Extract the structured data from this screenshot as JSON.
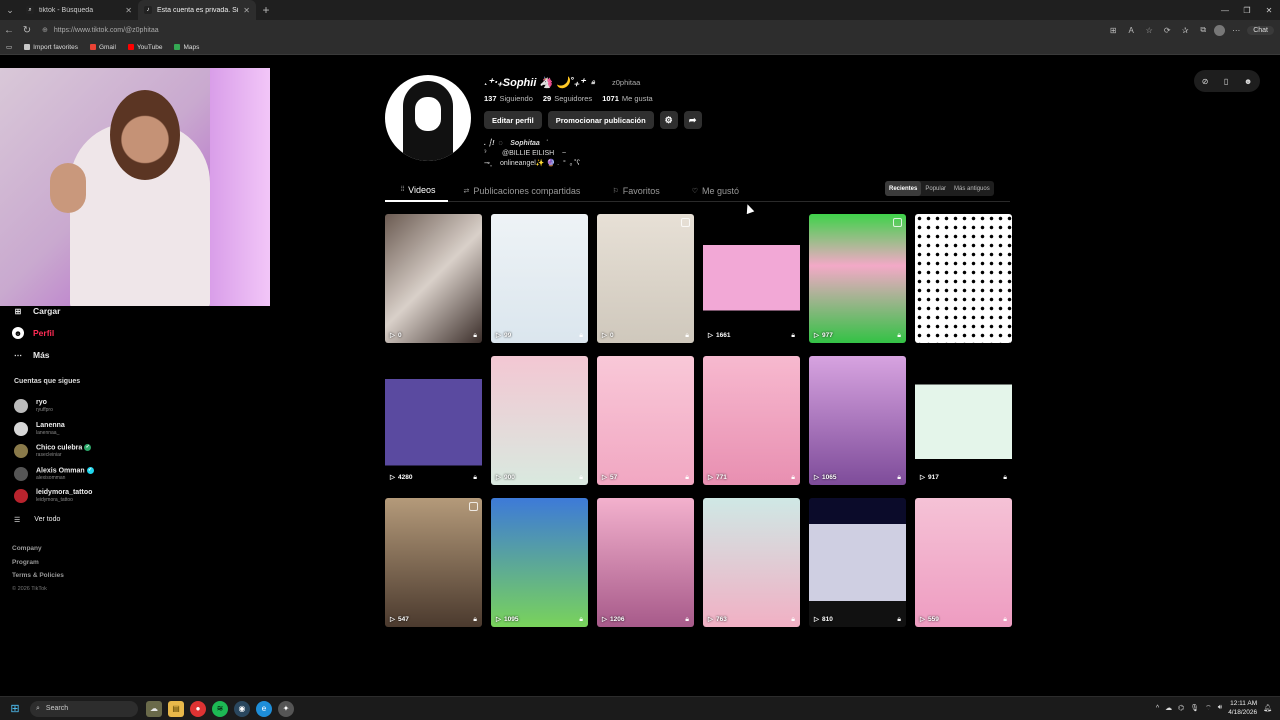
{
  "browser": {
    "tabs": [
      {
        "title": "tiktok - Búsqueda",
        "active": false
      },
      {
        "title": "Esta cuenta es privada. Sigue esta",
        "active": true
      }
    ],
    "url": "https://www.tiktok.com/@z0phitaa",
    "chat_label": "Chat",
    "bookmarks": [
      {
        "label": "Import favorites",
        "color": "#c8c8c8"
      },
      {
        "label": "Gmail",
        "color": "#ea4335"
      },
      {
        "label": "YouTube",
        "color": "#ff0000"
      },
      {
        "label": "Maps",
        "color": "#34a853"
      }
    ]
  },
  "sidebar": {
    "items": [
      {
        "label": "Cargar",
        "icon": "plus-square-icon",
        "active": false
      },
      {
        "label": "Perfil",
        "icon": "profile-icon",
        "active": true
      },
      {
        "label": "Más",
        "icon": "more-icon",
        "active": false
      }
    ],
    "following_heading": "Cuentas que sigues",
    "following": [
      {
        "name": "ryo",
        "user": "ryuffpro",
        "color": "#bbbbbb",
        "verified": ""
      },
      {
        "name": "Lanenna",
        "user": "lanennaa_",
        "color": "#d6d6d6",
        "verified": ""
      },
      {
        "name": "Chico culebra",
        "user": "rasecleiniar",
        "color": "#8a7a4a",
        "verified": "green"
      },
      {
        "name": "Alexis Omman",
        "user": "alexisomman",
        "color": "#555555",
        "verified": "blue"
      },
      {
        "name": "leidymora_tattoo",
        "user": "leidymora_tattoo",
        "color": "#b8232d",
        "verified": ""
      }
    ],
    "see_all": "Ver todo",
    "footer": [
      "Company",
      "Program",
      "Terms & Policies"
    ],
    "copyright": "© 2026 TikTok"
  },
  "profile": {
    "display_name": "˖⁺‧₊Sophii 🦄 🌙˚₊⁺",
    "handle": "z0phitaa",
    "following_count": "137",
    "following_label": "Siguiendo",
    "followers_count": "29",
    "followers_label": "Seguidores",
    "likes_count": "1071",
    "likes_label": "Me gusta",
    "edit_label": "Editar perfil",
    "promote_label": "Promocionar publicación",
    "bio_line1": ". ┆!  ◌    Sophitaa   ˙",
    "bio_line2": "ˀ        @BILLIE EILISH    ~",
    "bio_line3": "⊸˳    onlineangel✨ 🔮 .  °  ₒ ˚ʕ"
  },
  "tabs": [
    {
      "label": "Videos",
      "icon": "grid-icon",
      "active": true
    },
    {
      "label": "Publicaciones compartidas",
      "icon": "repost-icon",
      "active": false
    },
    {
      "label": "Favoritos",
      "icon": "bookmark-icon",
      "active": false
    },
    {
      "label": "Me gustó",
      "icon": "heart-icon",
      "active": false
    }
  ],
  "sort": [
    {
      "label": "Recientes",
      "active": true
    },
    {
      "label": "Popular",
      "active": false
    },
    {
      "label": "Más antiguos",
      "active": false
    }
  ],
  "videos": [
    {
      "views": "0",
      "bg": "linear-gradient(135deg,#6b5b52,#d9d0c9 50%,#3b2e2a)"
    },
    {
      "views": "99",
      "bg": "linear-gradient(180deg,#eef3f6,#dbe6ee)"
    },
    {
      "views": "0",
      "bg": "linear-gradient(180deg,#e7e0d6,#cfc8bc)"
    },
    {
      "views": "1661",
      "bg": "linear-gradient(180deg,#000 0 24%,#f2a8d6 24% 75%,#000 75%)"
    },
    {
      "views": "977",
      "bg": "linear-gradient(180deg,#3fd24a,#f3a9c7 40%,#33c245)"
    },
    {
      "views": "",
      "bg": "radial-gradient(circle,#000 1.5px,#fff 2px) 0 0/9px 9px"
    },
    {
      "views": "4280",
      "bg": "linear-gradient(180deg,#000 0 18%,#5a4aa0 18% 85%,#000 85%)"
    },
    {
      "views": "900",
      "bg": "linear-gradient(180deg,#f3c7d3,#d9e9df)"
    },
    {
      "views": "57",
      "bg": "linear-gradient(180deg,#f9c8d8,#f1a7c2)"
    },
    {
      "views": "771",
      "bg": "linear-gradient(180deg,#f7b9cf,#e88fb1)"
    },
    {
      "views": "1065",
      "bg": "linear-gradient(180deg,#d7a3e0,#7e4c9a)"
    },
    {
      "views": "917",
      "bg": "linear-gradient(180deg,#000 0 22%,#e4f5ea 22% 80%,#000 80%)"
    },
    {
      "views": "547",
      "bg": "linear-gradient(180deg,#b49a7a,#4b3a2e)"
    },
    {
      "views": "1095",
      "bg": "linear-gradient(180deg,#3d7ad8,#79d35b)"
    },
    {
      "views": "1206",
      "bg": "linear-gradient(180deg,#f3b1cd,#a75a8a)"
    },
    {
      "views": "763",
      "bg": "linear-gradient(180deg,#cfe8e5,#f1b0c4)"
    },
    {
      "views": "810",
      "bg": "linear-gradient(180deg,#0b0b2a 0 20%,#cfcfe2 20% 80%,#111 80%)"
    },
    {
      "views": "559",
      "bg": "linear-gradient(180deg,#f5c2d6,#ee9cc1)"
    }
  ],
  "taskbar": {
    "search_label": "Search",
    "time": "12:11 AM",
    "date": "4/18/2026"
  }
}
